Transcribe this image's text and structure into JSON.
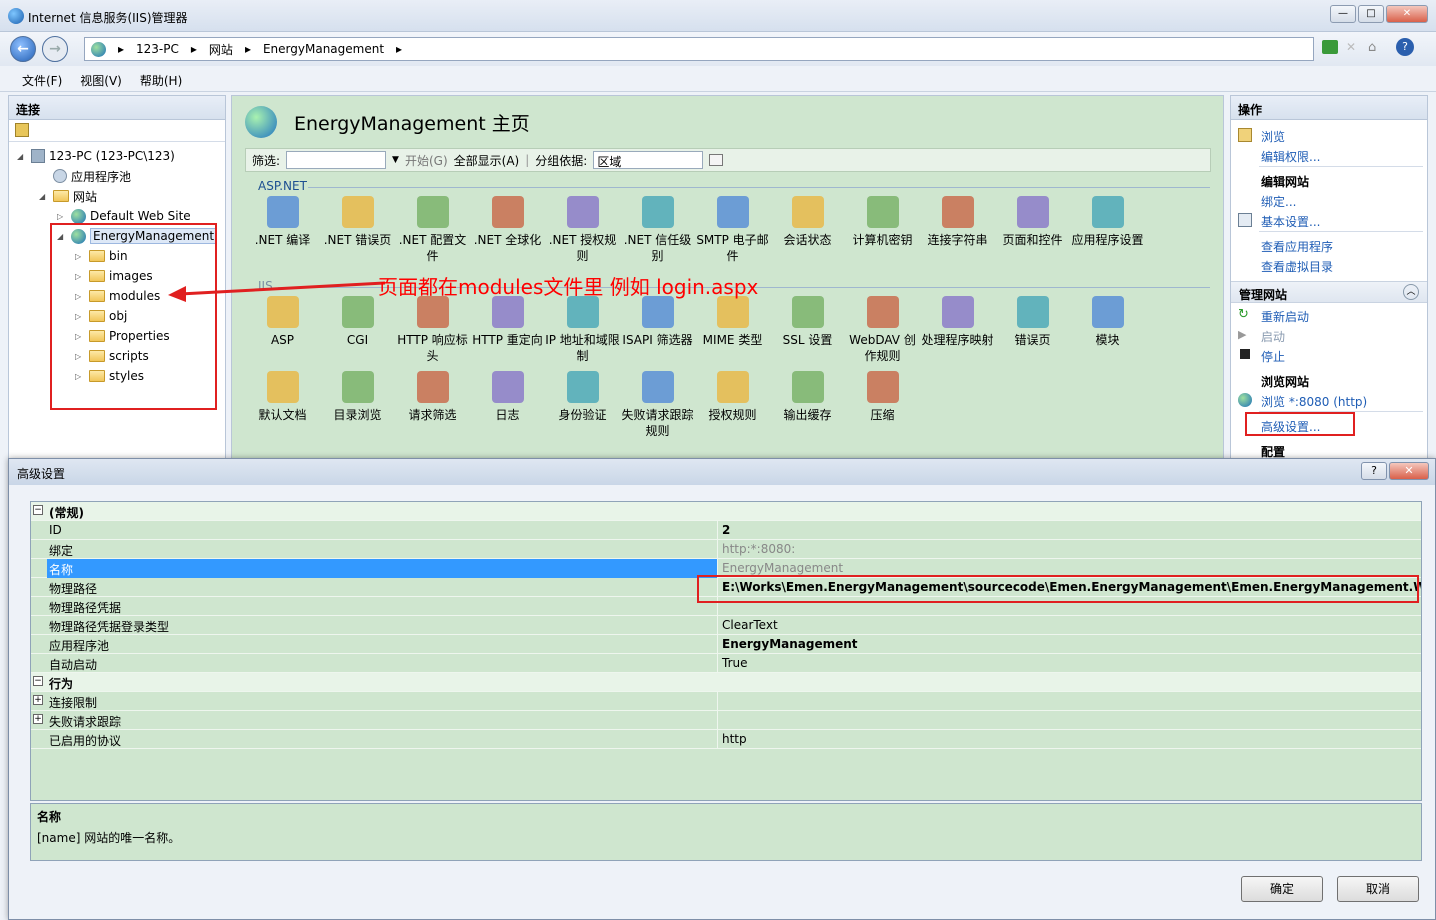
{
  "window": {
    "title": "Internet 信息服务(IIS)管理器"
  },
  "address": {
    "segments": [
      "123-PC",
      "网站",
      "EnergyManagement"
    ]
  },
  "menu": [
    "文件(F)",
    "视图(V)",
    "帮助(H)"
  ],
  "connections": {
    "header": "连接",
    "tree": [
      {
        "label": "123-PC (123-PC\\123)",
        "level": 0,
        "kind": "server"
      },
      {
        "label": "应用程序池",
        "level": 1,
        "kind": "pool"
      },
      {
        "label": "网站",
        "level": 1,
        "kind": "sites"
      },
      {
        "label": "Default Web Site",
        "level": 2,
        "kind": "site"
      },
      {
        "label": "EnergyManagement",
        "level": 2,
        "kind": "site",
        "selected": true
      },
      {
        "label": "bin",
        "level": 3,
        "kind": "folder"
      },
      {
        "label": "images",
        "level": 3,
        "kind": "folder"
      },
      {
        "label": "modules",
        "level": 3,
        "kind": "folder"
      },
      {
        "label": "obj",
        "level": 3,
        "kind": "folder"
      },
      {
        "label": "Properties",
        "level": 3,
        "kind": "folder"
      },
      {
        "label": "scripts",
        "level": 3,
        "kind": "folder"
      },
      {
        "label": "styles",
        "level": 3,
        "kind": "folder"
      }
    ]
  },
  "home": {
    "title": "EnergyManagement 主页",
    "filter_label": "筛选:",
    "start_label": "开始(G)",
    "show_all_label": "全部显示(A)",
    "group_label": "分组依据:",
    "group_value": "区域",
    "sections": [
      {
        "name": "ASP.NET",
        "features": [
          ".NET 编译",
          ".NET 错误页",
          ".NET 配置文件",
          ".NET 全球化",
          ".NET 授权规则",
          ".NET 信任级别",
          "SMTP 电子邮件",
          "会话状态",
          "计算机密钥",
          "连接字符串",
          "页面和控件",
          "应用程序设置"
        ]
      },
      {
        "name": "IIS",
        "features": [
          "ASP",
          "CGI",
          "HTTP 响应标头",
          "HTTP 重定向",
          "IP 地址和域限制",
          "ISAPI 筛选器",
          "MIME 类型",
          "SSL 设置",
          "WebDAV 创作规则",
          "处理程序映射",
          "错误页",
          "模块",
          "默认文档",
          "目录浏览",
          "请求筛选",
          "日志",
          "身份验证",
          "失败请求跟踪规则",
          "授权规则",
          "输出缓存",
          "压缩"
        ]
      }
    ]
  },
  "annotation": "页面都在modules文件里   例如  login.aspx",
  "actions": {
    "header": "操作",
    "browse": "浏览",
    "edit_perm": "编辑权限...",
    "edit_site": "编辑网站",
    "bindings": "绑定...",
    "basic": "基本设置...",
    "view_apps": "查看应用程序",
    "view_vdirs": "查看虚拟目录",
    "manage": "管理网站",
    "restart": "重新启动",
    "start": "启动",
    "stop": "停止",
    "browse_site": "浏览网站",
    "browse_8080": "浏览 *:8080 (http)",
    "advanced": "高级设置...",
    "config": "配置"
  },
  "dialog": {
    "title": "高级设置",
    "help": "?",
    "close": "✕",
    "rows": [
      {
        "type": "cat",
        "name": "(常规)",
        "toggle": "⊟"
      },
      {
        "name": "ID",
        "value": "2",
        "bold": true
      },
      {
        "name": "绑定",
        "value": "http:*:8080:",
        "gray": true
      },
      {
        "name": "名称",
        "value": "EnergyManagement",
        "gray": true,
        "highlight": true
      },
      {
        "name": "物理路径",
        "value": "E:\\Works\\Emen.EnergyManagement\\sourcecode\\Emen.EnergyManagement\\Emen.EnergyManagement.Web",
        "bold": true
      },
      {
        "name": "物理路径凭据",
        "value": ""
      },
      {
        "name": "物理路径凭据登录类型",
        "value": "ClearText"
      },
      {
        "name": "应用程序池",
        "value": "EnergyManagement",
        "bold": true
      },
      {
        "name": "自动启动",
        "value": "True"
      },
      {
        "type": "cat",
        "name": "行为",
        "toggle": "⊟"
      },
      {
        "name": "连接限制",
        "value": "",
        "toggle": "⊞"
      },
      {
        "name": "失败请求跟踪",
        "value": "",
        "toggle": "⊞"
      },
      {
        "name": "已启用的协议",
        "value": "http"
      }
    ],
    "desc_title": "名称",
    "desc_text": "[name] 网站的唯一名称。",
    "ok": "确定",
    "cancel": "取消"
  }
}
